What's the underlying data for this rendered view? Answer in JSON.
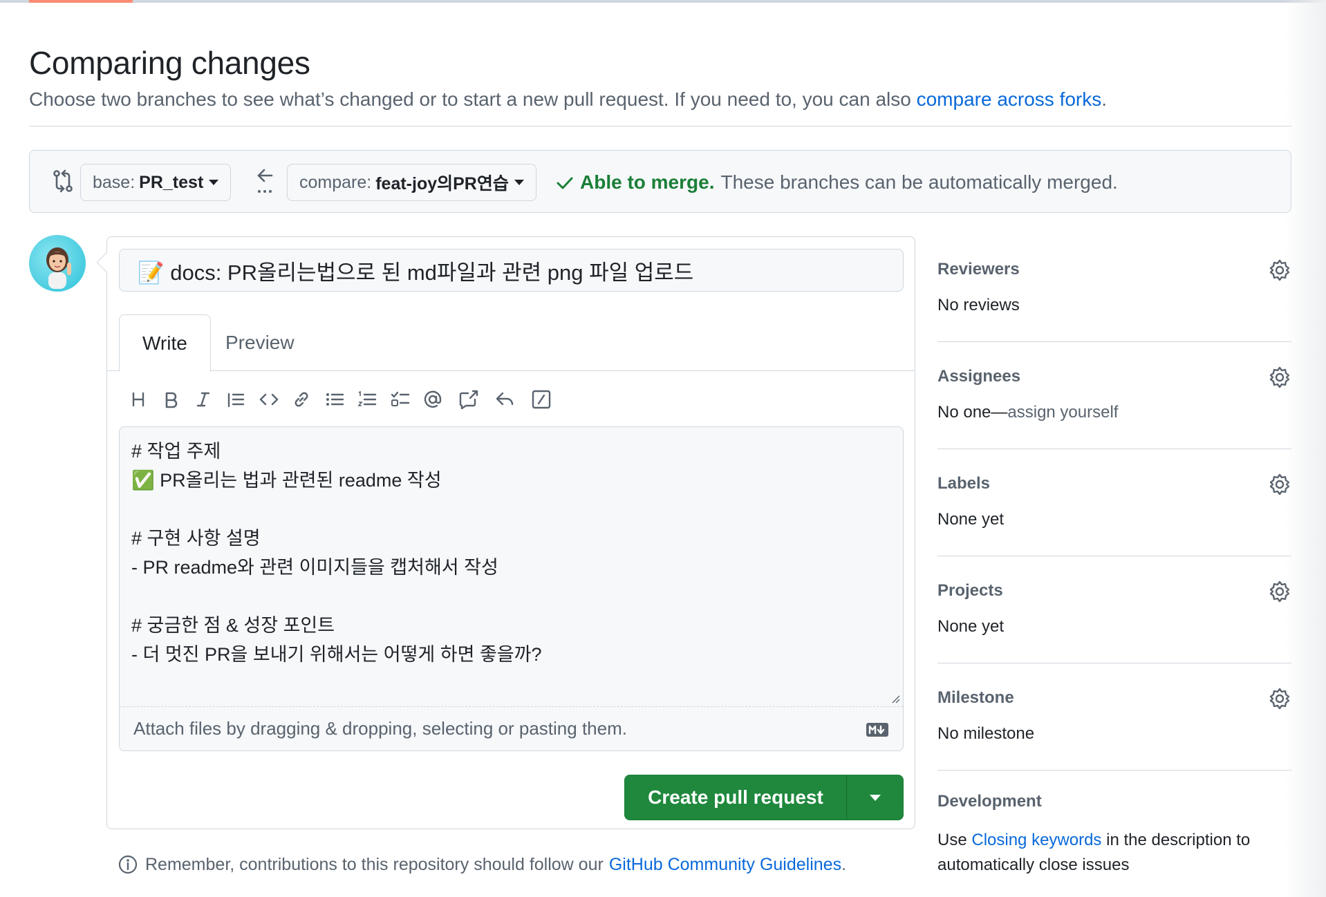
{
  "page": {
    "title": "Comparing changes",
    "subtitle_prefix": "Choose two branches to see what’s changed or to start a new pull request. If you need to, you can also ",
    "subtitle_link": "compare across forks",
    "subtitle_suffix": "."
  },
  "range": {
    "base_label": "base:",
    "base_branch": "PR_test",
    "compare_label": "compare:",
    "compare_branch": "feat-joy의PR연습",
    "merge_status": "Able to merge.",
    "merge_message": "These branches can be automatically merged."
  },
  "form": {
    "pr_title": "📝 docs: PR올리는법으로 된 md파일과 관련 png 파일 업로드",
    "tabs": [
      "Write",
      "Preview"
    ],
    "body_lines": [
      "# 작업 주제",
      "✅ PR올리는 법과 관련된 readme 작성",
      "",
      "# 구현 사항 설명",
      "- PR readme와 관련 이미지들을 캡처해서 작성",
      "",
      "# 궁금한 점 & 성장 포인트",
      "- 더 멋진 PR을 보내기 위해서는 어떻게 하면 좋을까?"
    ],
    "attach_hint": "Attach files by dragging & dropping, selecting or pasting them.",
    "create_label": "Create pull request",
    "toolbar_icons": [
      "heading-icon",
      "bold-icon",
      "italic-icon",
      "quote-icon",
      "code-icon",
      "link-icon",
      "bullet-list-icon",
      "numbered-list-icon",
      "task-list-icon",
      "mention-icon",
      "cross-reference-icon",
      "saved-reply-icon",
      "slash-commands-icon"
    ]
  },
  "footnote": {
    "text": "Remember, contributions to this repository should follow our",
    "link": "GitHub Community Guidelines",
    "suffix": "."
  },
  "sidebar": {
    "reviewers": {
      "title": "Reviewers",
      "value": "No reviews"
    },
    "assignees": {
      "title": "Assignees",
      "value_prefix": "No one—",
      "value_link": "assign yourself"
    },
    "labels": {
      "title": "Labels",
      "value": "None yet"
    },
    "projects": {
      "title": "Projects",
      "value": "None yet"
    },
    "milestone": {
      "title": "Milestone",
      "value": "No milestone"
    },
    "development": {
      "title": "Development",
      "prefix": "Use ",
      "link": "Closing keywords",
      "suffix": " in the description to automatically close issues"
    }
  },
  "colors": {
    "accent": "#0969da",
    "success": "#1f883d",
    "muted": "#59636e",
    "border": "#d0d7de"
  }
}
